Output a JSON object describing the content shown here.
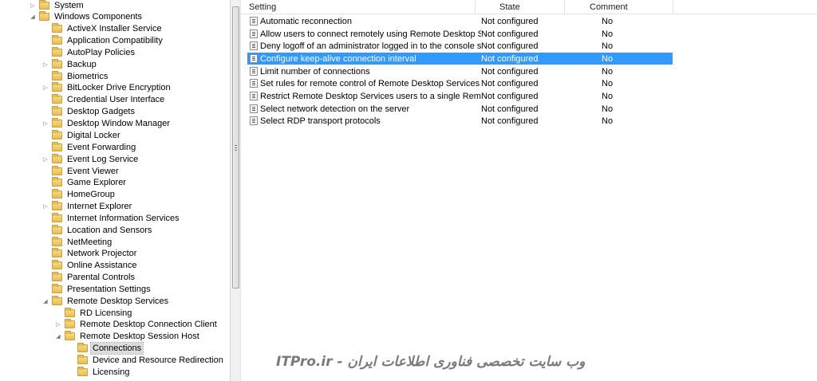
{
  "tree": {
    "items": [
      {
        "label": "System",
        "expander": "▷"
      },
      {
        "label": "Windows Components",
        "expander": "◢"
      },
      {
        "label": "ActiveX Installer Service",
        "expander": ""
      },
      {
        "label": "Application Compatibility",
        "expander": ""
      },
      {
        "label": "AutoPlay Policies",
        "expander": ""
      },
      {
        "label": "Backup",
        "expander": "▷"
      },
      {
        "label": "Biometrics",
        "expander": ""
      },
      {
        "label": "BitLocker Drive Encryption",
        "expander": "▷"
      },
      {
        "label": "Credential User Interface",
        "expander": ""
      },
      {
        "label": "Desktop Gadgets",
        "expander": ""
      },
      {
        "label": "Desktop Window Manager",
        "expander": "▷"
      },
      {
        "label": "Digital Locker",
        "expander": ""
      },
      {
        "label": "Event Forwarding",
        "expander": ""
      },
      {
        "label": "Event Log Service",
        "expander": "▷"
      },
      {
        "label": "Event Viewer",
        "expander": ""
      },
      {
        "label": "Game Explorer",
        "expander": ""
      },
      {
        "label": "HomeGroup",
        "expander": ""
      },
      {
        "label": "Internet Explorer",
        "expander": "▷"
      },
      {
        "label": "Internet Information Services",
        "expander": ""
      },
      {
        "label": "Location and Sensors",
        "expander": ""
      },
      {
        "label": "NetMeeting",
        "expander": ""
      },
      {
        "label": "Network Projector",
        "expander": ""
      },
      {
        "label": "Online Assistance",
        "expander": ""
      },
      {
        "label": "Parental Controls",
        "expander": ""
      },
      {
        "label": "Presentation Settings",
        "expander": ""
      },
      {
        "label": "Remote Desktop Services",
        "expander": "◢"
      },
      {
        "label": "RD Licensing",
        "expander": ""
      },
      {
        "label": "Remote Desktop Connection Client",
        "expander": "▷"
      },
      {
        "label": "Remote Desktop Session Host",
        "expander": "◢"
      },
      {
        "label": "Connections",
        "expander": ""
      },
      {
        "label": "Device and Resource Redirection",
        "expander": ""
      },
      {
        "label": "Licensing",
        "expander": ""
      }
    ]
  },
  "list": {
    "headers": {
      "setting": "Setting",
      "state": "State",
      "comment": "Comment"
    },
    "rows": [
      {
        "setting": "Automatic reconnection",
        "state": "Not configured",
        "comment": "No"
      },
      {
        "setting": "Allow users to connect remotely using Remote Desktop Serv...",
        "state": "Not configured",
        "comment": "No"
      },
      {
        "setting": "Deny logoff of an administrator logged in to the console ses...",
        "state": "Not configured",
        "comment": "No"
      },
      {
        "setting": "Configure keep-alive connection interval",
        "state": "Not configured",
        "comment": "No"
      },
      {
        "setting": "Limit number of connections",
        "state": "Not configured",
        "comment": "No"
      },
      {
        "setting": "Set rules for remote control of Remote Desktop Services use...",
        "state": "Not configured",
        "comment": "No"
      },
      {
        "setting": "Restrict Remote Desktop Services users to a single Remote D...",
        "state": "Not configured",
        "comment": "No"
      },
      {
        "setting": "Select network detection on the server",
        "state": "Not configured",
        "comment": "No"
      },
      {
        "setting": "Select RDP transport protocols",
        "state": "Not configured",
        "comment": "No"
      }
    ]
  },
  "watermark": "ITPro.ir - وب سایت تخصصی فناوری اطلاعات ایران",
  "colors": {
    "selection": "#3399ff",
    "folder": "#e9bd4b"
  }
}
